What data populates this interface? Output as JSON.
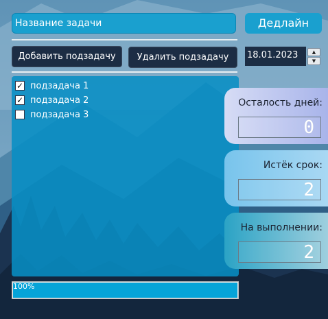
{
  "task": {
    "title_value": "Название задачи",
    "deadline_label": "Дедлайн",
    "date_value": "18.01.2023",
    "add_subtask_label": "Добавить подзадачу",
    "remove_subtask_label": "Удалить подзадачу"
  },
  "subtasks": [
    {
      "label": "подзадача 1",
      "checked": true
    },
    {
      "label": "подзадача 2",
      "checked": true
    },
    {
      "label": "подзадача 3",
      "checked": false
    }
  ],
  "stats": [
    {
      "label": "Осталость дней:",
      "value": "0"
    },
    {
      "label": "Истёк срок:",
      "value": "2"
    },
    {
      "label": "На выполнении:",
      "value": "2"
    }
  ],
  "progress": {
    "value": 100,
    "label": "100%"
  },
  "colors": {
    "accent": "#1aa0cf",
    "dark_button": "#1c2d44",
    "progress_fill": "#06a4d8"
  }
}
